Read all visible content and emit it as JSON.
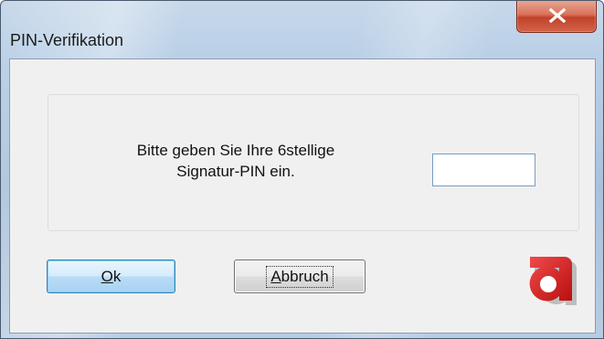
{
  "window": {
    "title": "PIN-Verifikation",
    "close_icon": "close-icon"
  },
  "prompt": {
    "line1": "Bitte geben Sie Ihre 6stellige",
    "line2": "Signatur-PIN ein."
  },
  "pin_field": {
    "value": ""
  },
  "buttons": {
    "ok": {
      "mnemonic": "O",
      "rest": "k"
    },
    "cancel": {
      "mnemonic": "A",
      "rest": "bbruch"
    }
  },
  "logo": {
    "icon": "a-logo-icon",
    "color": "#d11f1f"
  }
}
